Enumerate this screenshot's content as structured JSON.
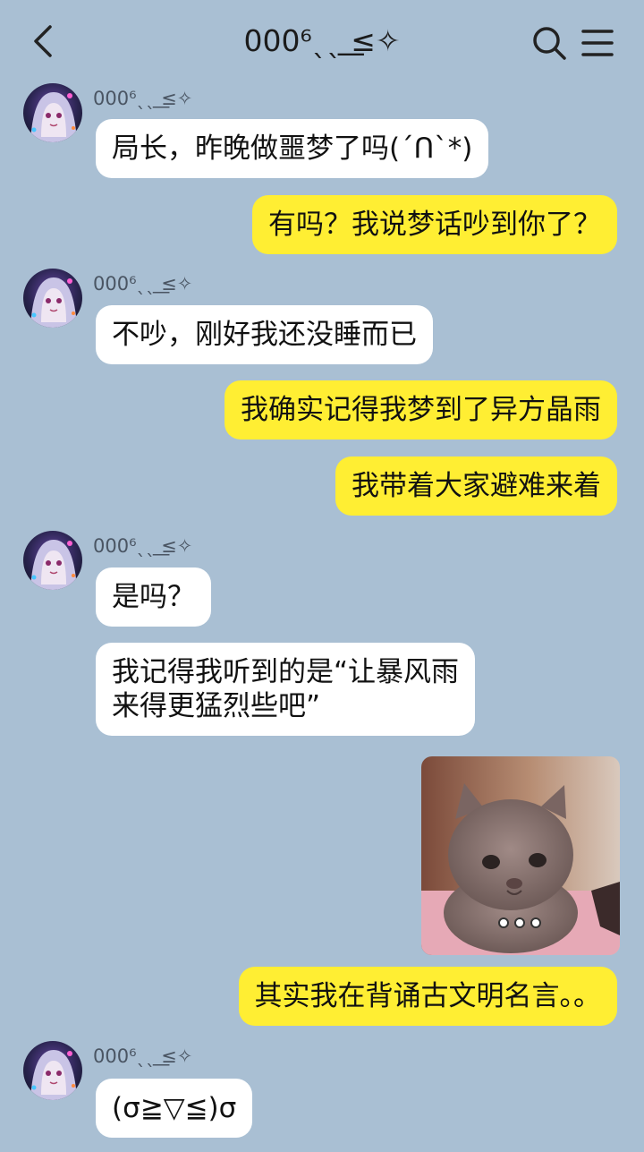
{
  "header": {
    "title": "000⁶ˎˎ ͟≤✧"
  },
  "contact": {
    "name": "000⁶ˎˎ ͟≤✧"
  },
  "messages": [
    {
      "side": "left",
      "text": "局长，昨晚做噩梦了吗(´Ո`*)"
    },
    {
      "side": "right",
      "text": "有吗？我说梦话吵到你了？"
    },
    {
      "side": "left",
      "text": "不吵，刚好我还没睡而已"
    },
    {
      "side": "right",
      "text": "我确实记得我梦到了异方晶雨"
    },
    {
      "side": "right",
      "text": "我带着大家避难来着"
    },
    {
      "side": "left",
      "text": "是吗？"
    },
    {
      "side": "left",
      "line1": "我记得我听到的是“让暴风雨",
      "line2": "来得更猛烈些吧”"
    },
    {
      "side": "right",
      "text": "其实我在背诵古文明名言。。"
    },
    {
      "side": "left",
      "text": "(σ≧▽≦)σ"
    }
  ],
  "photo": {
    "kind": "kitten photo"
  },
  "colors": {
    "background": "#a9bfd3",
    "self_bubble": "#ffee33",
    "other_bubble": "#ffffff"
  },
  "icons": [
    "back-arrow-icon",
    "search-icon",
    "menu-icon",
    "more-dots-icon"
  ]
}
